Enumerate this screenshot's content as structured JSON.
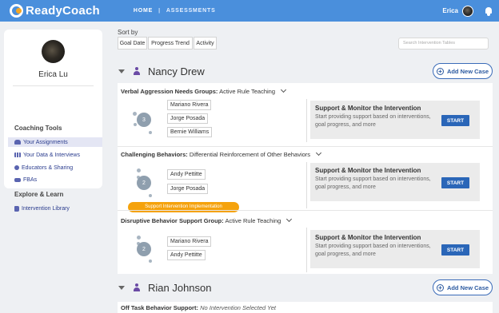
{
  "brand": {
    "name": "ReadyCoach"
  },
  "nav": {
    "home": "HOME",
    "separator": "|",
    "assessments": "ASSESSMENTS"
  },
  "user": {
    "name": "Erica"
  },
  "sidebar": {
    "profile_name": "Erica Lu",
    "coaching_tools_heading": "Coaching Tools",
    "coaching_items": [
      {
        "label": "Your Assignments",
        "icon": "users-icon",
        "active": true
      },
      {
        "label": "Your Data & Interviews",
        "icon": "table-icon",
        "active": false
      },
      {
        "label": "Educators & Sharing",
        "icon": "share-icon",
        "active": false
      },
      {
        "label": "FBAs",
        "icon": "fba-icon",
        "active": false
      }
    ],
    "explore_heading": "Explore & Learn",
    "explore_items": [
      {
        "label": "Intervention Library",
        "icon": "library-icon"
      }
    ]
  },
  "sort": {
    "label": "Sort by",
    "options": [
      "Goal Date",
      "Progress Trend",
      "Activity"
    ]
  },
  "search": {
    "placeholder": "Search Intervention Tables"
  },
  "add_case_label": "Add New Case",
  "support": {
    "title": "Support & Monitor the Intervention",
    "description": "Start providing support based on interventions, goal progress, and more",
    "start_label": "START"
  },
  "students": [
    {
      "name": "Nancy Drew",
      "cases": [
        {
          "group": "Verbal Aggression Needs Groups:",
          "intervention": "Active Rule Teaching",
          "count": "3",
          "members": [
            "Mariano Rivera",
            "Jorge Posada",
            "Bernie Williams"
          ]
        },
        {
          "group": "Challenging Behaviors:",
          "intervention": "Differential Reinforcement of Other Behaviors",
          "count": "2",
          "members": [
            "Andy Pettitte",
            "Jorge Posada"
          ],
          "badge": "Support Intervention Implementation"
        },
        {
          "group": "Disruptive Behavior Support Group:",
          "intervention": "Active Rule Teaching",
          "count": "2",
          "members": [
            "Mariano Rivera",
            "Andy Pettitte"
          ]
        }
      ]
    },
    {
      "name": "Rian Johnson",
      "cases": [
        {
          "group": "Off Task Behavior Support:",
          "intervention": "No Intervention Selected Yet"
        }
      ]
    }
  ],
  "colors": {
    "topbar": "#4a8fdc",
    "accent": "#2a66b8",
    "badge": "#f5a20c",
    "student_icon": "#6a4aa5"
  }
}
